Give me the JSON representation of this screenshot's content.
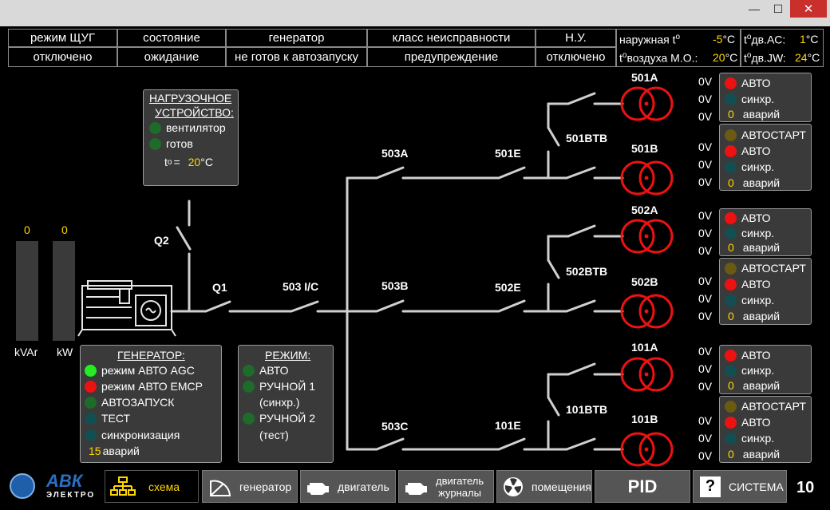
{
  "titlebar": {
    "minimize": "—",
    "maximize": "☐",
    "close": "✕"
  },
  "header": {
    "cells": [
      {
        "title": "режим ЩУГ",
        "value": "отключено"
      },
      {
        "title": "состояние",
        "value": "ожидание"
      },
      {
        "title": "генератор",
        "value": "не готов к автозапуску"
      },
      {
        "title": "класс неисправности",
        "value": "предупреждение"
      },
      {
        "title": "Н.У.",
        "value": "отключено"
      }
    ],
    "temps": {
      "outside_label": "наружная t",
      "outside_sup": "o",
      "outside_value": "-5",
      "outside_unit": "°C",
      "air_label": "t",
      "air_sup": "o",
      "air_label2": "воздуха М.О.:",
      "air_value": "20",
      "air_unit": "°C",
      "ac_label": "t",
      "ac_sup": "o",
      "ac_label2": "дв.AC:",
      "ac_value": "1",
      "ac_unit": "°C",
      "jw_label": "t",
      "jw_sup": "o",
      "jw_label2": "дв.JW:",
      "jw_value": "24",
      "jw_unit": "°C"
    }
  },
  "load_device": {
    "title1": "НАГРУЗОЧНОЕ",
    "title2": "УСТРОЙСТВО:",
    "items": [
      "вентилятор",
      "готов"
    ],
    "temp_label": "t",
    "temp_sup": "o",
    "temp_eq": "=",
    "temp_value": "20",
    "temp_unit": "°C"
  },
  "bars": {
    "kvar_value": "0",
    "kw_value": "0",
    "kvar_label": "kVAr",
    "kw_label": "kW"
  },
  "generator_panel": {
    "title": "ГЕНЕРАТОР:",
    "items": [
      "режим АВТО AGC",
      "режим АВТО EMCP",
      "АВТОЗАПУСК",
      "ТЕСТ",
      "синхронизация"
    ],
    "alarm_count": "15",
    "alarm_label": "аварий"
  },
  "mode_panel": {
    "title": "РЕЖИМ:",
    "items": [
      "АВТО",
      "РУЧНОЙ 1",
      "(синхр.)",
      "РУЧНОЙ 2",
      "(тест)"
    ]
  },
  "diagram": {
    "labels": {
      "q2": "Q2",
      "q1": "Q1",
      "s503ic": "503 I/C",
      "s503a": "503A",
      "s503b": "503B",
      "s503c": "503C",
      "s501e": "501E",
      "s502e": "502E",
      "s101e": "101E",
      "t501a": "501A",
      "t501b": "501B",
      "t502a": "502A",
      "t502b": "502B",
      "t101a": "101A",
      "t101b": "101B",
      "b501": "501BTB",
      "b502": "502BTB",
      "b101": "101BTB"
    },
    "voltages": [
      "0V",
      "0V",
      "0V",
      "0V",
      "0V",
      "0V",
      "0V",
      "0V",
      "0V",
      "0V",
      "0V",
      "0V",
      "0V",
      "0V",
      "0V",
      "0V",
      "0V",
      "0V"
    ]
  },
  "status_panels": {
    "a_rows": [
      "АВТО",
      "синхр.",
      "аварий"
    ],
    "b_rows": [
      "АВТОСТАРТ",
      "АВТО",
      "синхр.",
      "аварий"
    ],
    "alarm_value": "0"
  },
  "nav": {
    "logo_top": "АВК",
    "logo_bottom": "ЭЛЕКТРО",
    "scheme": "схема",
    "generator": "генератор",
    "engine": "двигатель",
    "engine_logs_1": "двигатель",
    "engine_logs_2": "журналы",
    "rooms": "помещения",
    "pid": "PID",
    "help": "?",
    "system": "СИСТЕМА",
    "page": "10"
  },
  "colors": {
    "accent_yellow": "#ffd700",
    "transformer_red": "#ee1111",
    "indicator_green": "#22ee22"
  }
}
